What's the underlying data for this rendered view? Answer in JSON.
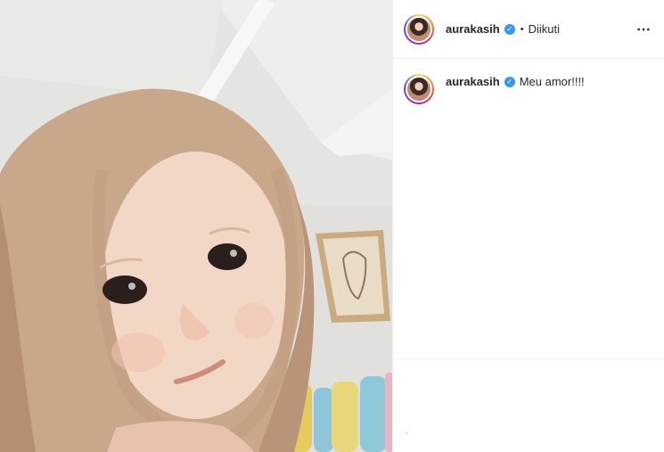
{
  "post": {
    "username": "aurakasih",
    "follow_status": "Diikuti",
    "separator": "•",
    "more_icon": "⋯",
    "verified_icon": "✓"
  },
  "caption": {
    "username": "aurakasih",
    "text": "Meu amor!!!!"
  },
  "colors": {
    "verified_badge": "#3897f0",
    "hijab": "#c6a487",
    "background": "#ffffff"
  }
}
